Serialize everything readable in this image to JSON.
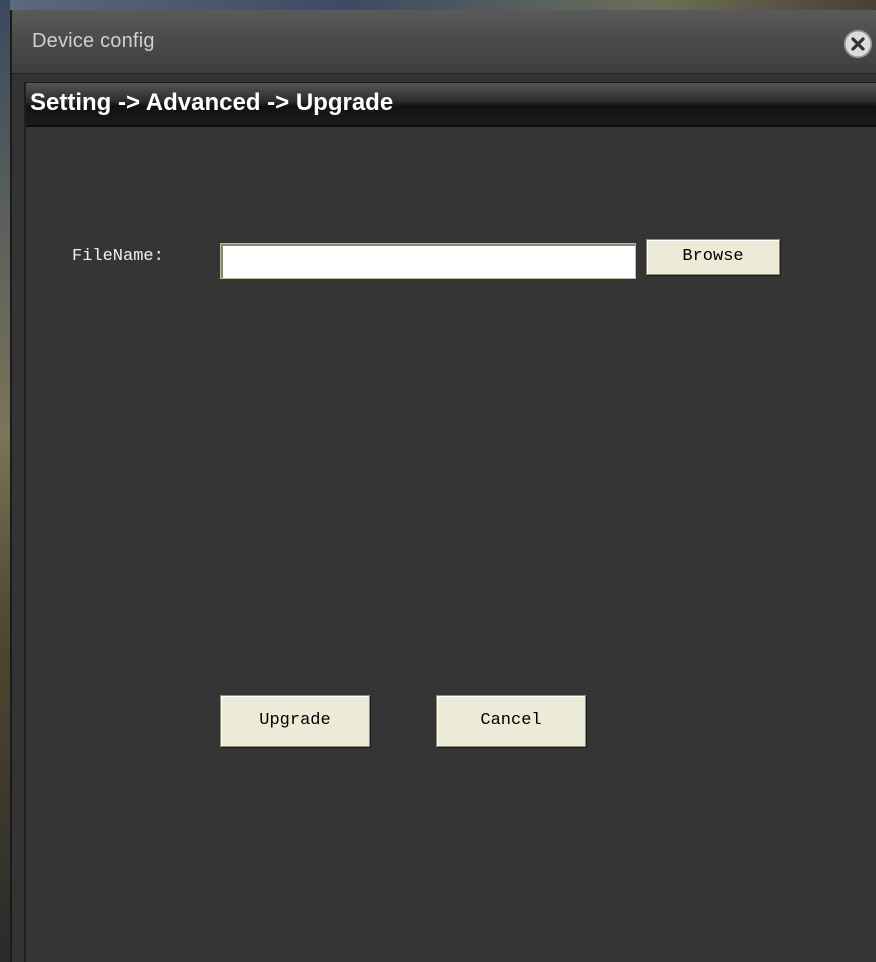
{
  "window": {
    "title": "Device config",
    "close_icon": "close-icon"
  },
  "breadcrumb": {
    "text": "Setting -> Advanced -> Upgrade"
  },
  "form": {
    "filename_label": "FileName:",
    "filename_value": "",
    "filename_placeholder": "",
    "browse_label": "Browse"
  },
  "actions": {
    "upgrade_label": "Upgrade",
    "cancel_label": "Cancel"
  }
}
